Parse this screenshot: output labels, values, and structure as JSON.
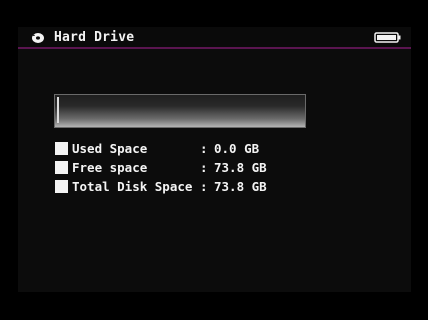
{
  "header": {
    "title": "Hard Drive",
    "left_icon": "disc-icon",
    "right_icon": "battery-icon"
  },
  "storage": {
    "used_fraction": 0.0,
    "rows": [
      {
        "label": "Used Space",
        "separator": ":",
        "value": "0.0 GB"
      },
      {
        "label": "Free space",
        "separator": ":",
        "value": "73.8 GB"
      },
      {
        "label": "Total Disk Space",
        "separator": ":",
        "value": "73.8 GB"
      }
    ]
  },
  "colors": {
    "background": "#000000",
    "screen": "#0c0c0c",
    "accent_line": "#5a1550",
    "text": "#f4f4f4"
  }
}
